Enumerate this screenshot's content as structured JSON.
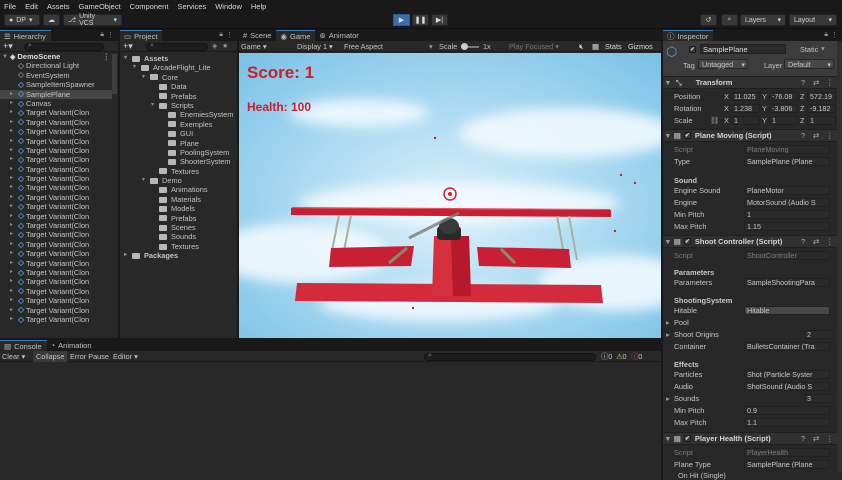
{
  "menu": [
    "File",
    "Edit",
    "Assets",
    "GameObject",
    "Component",
    "Services",
    "Window",
    "Help"
  ],
  "toolbar": {
    "account": "DP",
    "vcs": "Unity VCS",
    "layers": "Layers",
    "layout": "Layout"
  },
  "hierarchy": {
    "tab": "Hierarchy",
    "scene": "DemoScene",
    "items": [
      {
        "label": "Directional Light",
        "indent": 2,
        "blue": false
      },
      {
        "label": "EventSystem",
        "indent": 2,
        "blue": false
      },
      {
        "label": "SampleItemSpawner",
        "indent": 2,
        "blue": true
      },
      {
        "label": "SamplePlane",
        "indent": 2,
        "blue": true,
        "selected": true,
        "arrow": true
      },
      {
        "label": "Canvas",
        "indent": 2,
        "blue": true,
        "arrow": true
      },
      {
        "label": "Target Variant(Clon",
        "indent": 2,
        "blue": true,
        "arrow": true
      },
      {
        "label": "Target Variant(Clon",
        "indent": 2,
        "blue": true,
        "arrow": true
      },
      {
        "label": "Target Variant(Clon",
        "indent": 2,
        "blue": true,
        "arrow": true
      },
      {
        "label": "Target Variant(Clon",
        "indent": 2,
        "blue": true,
        "arrow": true
      },
      {
        "label": "Target Variant(Clon",
        "indent": 2,
        "blue": true,
        "arrow": true
      },
      {
        "label": "Target Variant(Clon",
        "indent": 2,
        "blue": true,
        "arrow": true
      },
      {
        "label": "Target Variant(Clon",
        "indent": 2,
        "blue": true,
        "arrow": true
      },
      {
        "label": "Target Variant(Clon",
        "indent": 2,
        "blue": true,
        "arrow": true
      },
      {
        "label": "Target Variant(Clon",
        "indent": 2,
        "blue": true,
        "arrow": true
      },
      {
        "label": "Target Variant(Clon",
        "indent": 2,
        "blue": true,
        "arrow": true
      },
      {
        "label": "Target Variant(Clon",
        "indent": 2,
        "blue": true,
        "arrow": true
      },
      {
        "label": "Target Variant(Clon",
        "indent": 2,
        "blue": true,
        "arrow": true
      },
      {
        "label": "Target Variant(Clon",
        "indent": 2,
        "blue": true,
        "arrow": true
      },
      {
        "label": "Target Variant(Clon",
        "indent": 2,
        "blue": true,
        "arrow": true
      },
      {
        "label": "Target Variant(Clon",
        "indent": 2,
        "blue": true,
        "arrow": true
      },
      {
        "label": "Target Variant(Clon",
        "indent": 2,
        "blue": true,
        "arrow": true
      },
      {
        "label": "Target Variant(Clon",
        "indent": 2,
        "blue": true,
        "arrow": true
      },
      {
        "label": "Target Variant(Clon",
        "indent": 2,
        "blue": true,
        "arrow": true
      },
      {
        "label": "Target Variant(Clon",
        "indent": 2,
        "blue": true,
        "arrow": true
      },
      {
        "label": "Target Variant(Clon",
        "indent": 2,
        "blue": true,
        "arrow": true
      },
      {
        "label": "Target Variant(Clon",
        "indent": 2,
        "blue": true,
        "arrow": true
      },
      {
        "label": "Target Variant(Clon",
        "indent": 2,
        "blue": true,
        "arrow": true
      },
      {
        "label": "Target Variant(Clon",
        "indent": 2,
        "blue": true,
        "arrow": true
      }
    ]
  },
  "project": {
    "tab": "Project",
    "items": [
      {
        "label": "Assets",
        "indent": 0,
        "bold": true
      },
      {
        "label": "ArcadeFlight_Lite",
        "indent": 1
      },
      {
        "label": "Core",
        "indent": 2
      },
      {
        "label": "Data",
        "indent": 3
      },
      {
        "label": "Prefabs",
        "indent": 3
      },
      {
        "label": "Scripts",
        "indent": 3
      },
      {
        "label": "EnemiesSystem",
        "indent": 4
      },
      {
        "label": "Exemples",
        "indent": 4
      },
      {
        "label": "GUI",
        "indent": 4
      },
      {
        "label": "Plane",
        "indent": 4
      },
      {
        "label": "PoolingSystem",
        "indent": 4
      },
      {
        "label": "ShooterSystem",
        "indent": 4
      },
      {
        "label": "Textures",
        "indent": 3
      },
      {
        "label": "Demo",
        "indent": 2
      },
      {
        "label": "Animations",
        "indent": 3
      },
      {
        "label": "Materials",
        "indent": 3
      },
      {
        "label": "Models",
        "indent": 3
      },
      {
        "label": "Prefabs",
        "indent": 3
      },
      {
        "label": "Scenes",
        "indent": 3
      },
      {
        "label": "Sounds",
        "indent": 3
      },
      {
        "label": "Textures",
        "indent": 3
      },
      {
        "label": "Packages",
        "indent": 0,
        "bold": true
      }
    ]
  },
  "game": {
    "tabs": [
      "Scene",
      "Game",
      "Animator"
    ],
    "mode": "Game",
    "display": "Display 1",
    "aspect": "Free Aspect",
    "scale_label": "Scale",
    "scale_value": "1x",
    "play_focused": "Play Focused",
    "stats": "Stats",
    "gizmos": "Gizmos",
    "score": "Score: 1",
    "health": "Health: 100"
  },
  "console": {
    "tabs": [
      "Console",
      "Animation"
    ],
    "buttons": [
      "Clear",
      "Collapse",
      "Error Pause",
      "Editor"
    ],
    "counts": [
      "0",
      "0",
      "0"
    ]
  },
  "inspector": {
    "tab": "Inspector",
    "object_name": "SamplePlane",
    "static": "Static",
    "tag_label": "Tag",
    "tag": "Untagged",
    "layer_label": "Layer",
    "layer": "Default",
    "transform": {
      "title": "Transform",
      "position_label": "Position",
      "rotation_label": "Rotation",
      "scale_label": "Scale",
      "position": [
        "11.025",
        "-76.08",
        "572.19"
      ],
      "rotation": [
        "1.238",
        "-3.806",
        "-9.182"
      ],
      "scale": [
        "1",
        "1",
        "1"
      ]
    },
    "plane_moving": {
      "title": "Plane Moving (Script)",
      "script_label": "Script",
      "script": "PlaneMoving",
      "type_label": "Type",
      "type": "SamplePlane (Plane",
      "sound_header": "Sound",
      "engine_sound_label": "Engine Sound",
      "engine_sound": "PlaneMotor",
      "engine_label": "Engine",
      "engine": "MotorSound (Audio S",
      "min_pitch_label": "Min Pitch",
      "min_pitch": "1",
      "max_pitch_label": "Max Pitch",
      "max_pitch": "1.15"
    },
    "shoot": {
      "title": "Shoot Controller (Script)",
      "script_label": "Script",
      "script": "ShootController",
      "params_header": "Parameters",
      "params_label": "Parameters",
      "params": "SampleShootingPara",
      "system_header": "ShootingSystem",
      "hitable_label": "Hitable",
      "hitable": "Hitable",
      "pool_label": "Pool",
      "origins_label": "Shoot Origins",
      "origins": "2",
      "container_label": "Container",
      "container": "BulletsContainer (Tra",
      "effects_header": "Effects",
      "particles_label": "Particles",
      "particles": "Shot (Particle Syster",
      "audio_label": "Audio",
      "audio": "ShotSound (Audio S",
      "sounds_label": "Sounds",
      "sounds": "3",
      "min_pitch_label": "Min Pitch",
      "min_pitch": "0.9",
      "max_pitch_label": "Max Pitch",
      "max_pitch": "1.1"
    },
    "health": {
      "title": "Player Health (Script)",
      "script_label": "Script",
      "script": "PlayerHealth",
      "plane_type_label": "Plane Type",
      "plane_type": "SamplePlane (Plane",
      "on_hit": "On Hit (Single)"
    }
  },
  "colors": {
    "accent": "#3a79bb",
    "score": "#c8202c",
    "wing": "#d0283a"
  }
}
